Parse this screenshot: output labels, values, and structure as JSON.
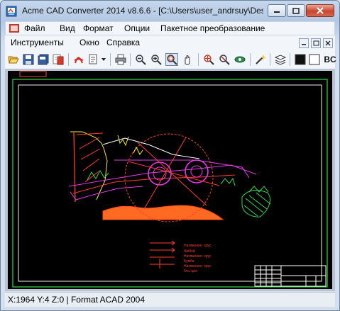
{
  "window": {
    "title": "Acme CAD Converter 2014 v8.6.6 - [C:\\Users\\user_andrsuy\\Des...",
    "controls": [
      "minimize",
      "maximize",
      "close"
    ]
  },
  "menu": {
    "row1": [
      "Файл",
      "Вид",
      "Формат",
      "Опции",
      "Пакетное преобразование"
    ],
    "row2": [
      "Инструменты",
      "Окно",
      "Справка"
    ]
  },
  "toolbar": {
    "icons": [
      "open-icon",
      "save-icon",
      "save-all-icon",
      "convert-icon",
      "pdf-icon",
      "export-dropdown-icon",
      "print-icon",
      "zoom-out-icon",
      "zoom-in-icon",
      "zoom-window-icon",
      "pan-icon",
      "zoom-realtime-icon",
      "zoom-extents-icon",
      "orbit-icon",
      "magic-icon",
      "layers-icon",
      "black-background-icon"
    ],
    "trailing_label": "BC"
  },
  "drawing": {
    "labels": [
      "Натяжение: хрус",
      "Шибёй",
      "Натяжение: хрус",
      "Бумба",
      "Натяжение: хрус",
      "Ось цил"
    ]
  },
  "status": {
    "text": "X:1964 Y:4 Z:0 | Format ACAD 2004"
  },
  "colors": {
    "accent": "#c6392d",
    "canvas_bg": "#000000",
    "drawing_green": "#35d84a",
    "drawing_magenta": "#e53be4",
    "drawing_red": "#ff3b2f",
    "drawing_orange": "#ff6a22",
    "drawing_yellow": "#f4ee2e"
  }
}
